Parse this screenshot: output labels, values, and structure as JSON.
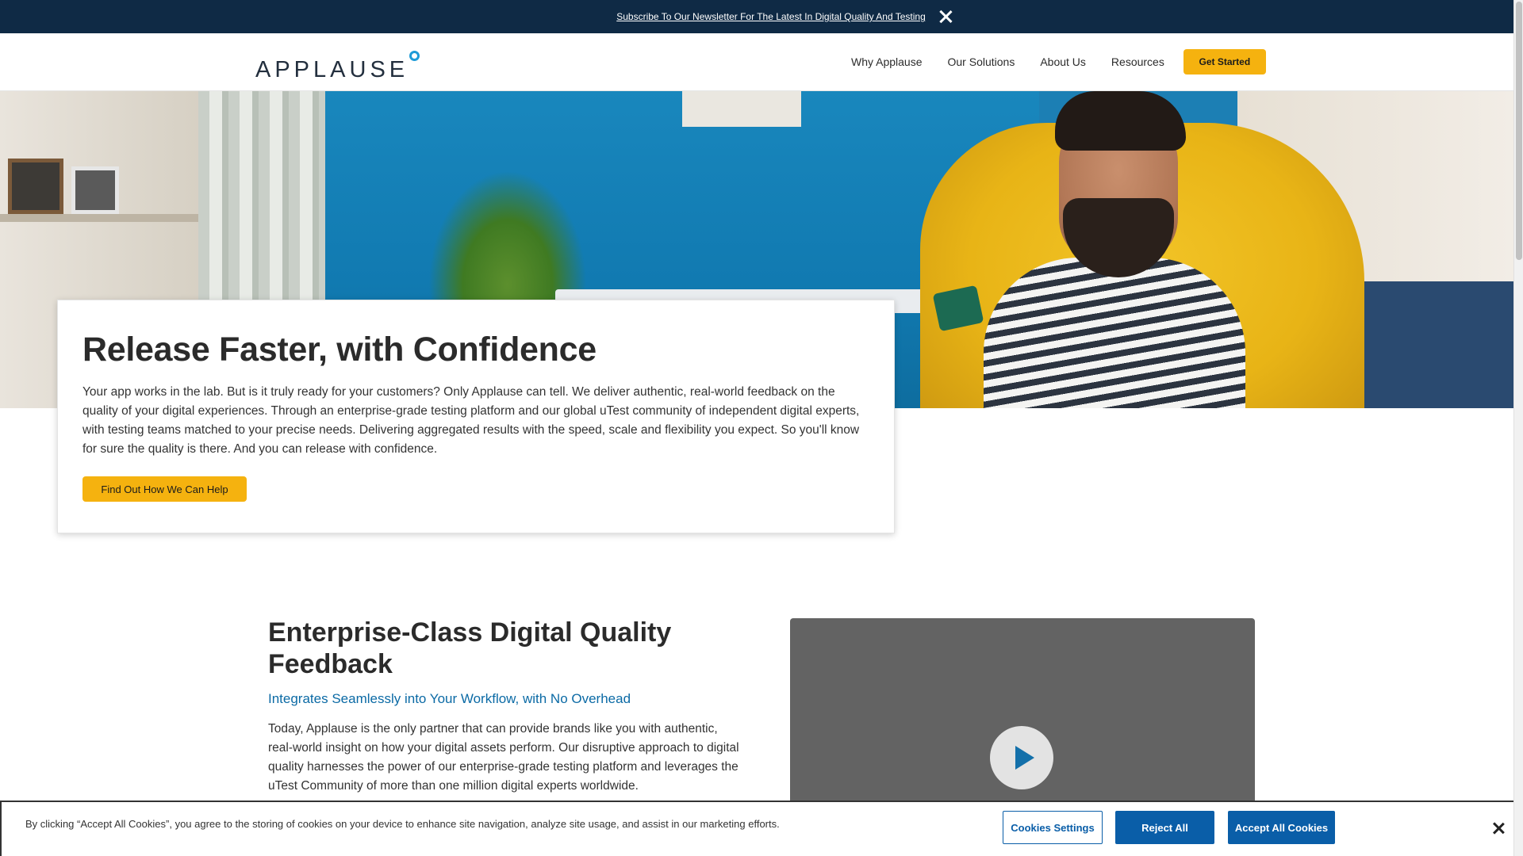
{
  "topbar": {
    "newsletter_link": "Subscribe To Our Newsletter For The Latest In Digital Quality And Testing"
  },
  "header": {
    "logo_text": "APPLAUSE",
    "nav": [
      {
        "label": "Why Applause"
      },
      {
        "label": "Our Solutions"
      },
      {
        "label": "About Us"
      },
      {
        "label": "Resources"
      }
    ],
    "cta_label": "Get Started"
  },
  "hero": {
    "title": "Release Faster, with Confidence",
    "body": "Your app works in the lab. But is it truly ready for your customers? Only Applause can tell. We deliver authentic, real-world feedback on the quality of your digital experiences. Through an enterprise-grade testing platform and our global uTest community of independent digital experts, with testing teams matched to your precise needs. Delivering aggregated results with the speed, scale and flexibility you expect. So you'll know for sure the quality is there. And you can release with confidence.",
    "button_label": "Find Out How We Can Help"
  },
  "enterprise": {
    "title": "Enterprise-Class Digital Quality Feedback",
    "subtitle": "Integrates Seamlessly into Your Workflow, with No Overhead",
    "body": "Today, Applause is the only partner that can provide brands like you with authentic, real-world insight on how your digital assets perform. Our disruptive approach to digital quality harnesses the power of our enterprise-grade testing platform and leverages the uTest Community of more than one million digital experts worldwide."
  },
  "cookie": {
    "text": "By clicking “Accept All Cookies”, you agree to the storing of cookies on your device to enhance site navigation, analyze site usage, and assist in our marketing efforts.",
    "settings_label": "Cookies Settings",
    "reject_label": "Reject All",
    "accept_label": "Accept All Cookies"
  },
  "colors": {
    "topbar_bg": "#0f2a45",
    "accent_yellow": "#f5b20f",
    "link_blue": "#0b6aa5",
    "cookie_blue": "#0a5ea8",
    "logo_ring": "#1e9bd7"
  },
  "icons": {
    "topbar_close": "close-icon",
    "logo_ring": "circle-icon",
    "video_play": "play-icon",
    "cookie_close": "close-icon"
  }
}
